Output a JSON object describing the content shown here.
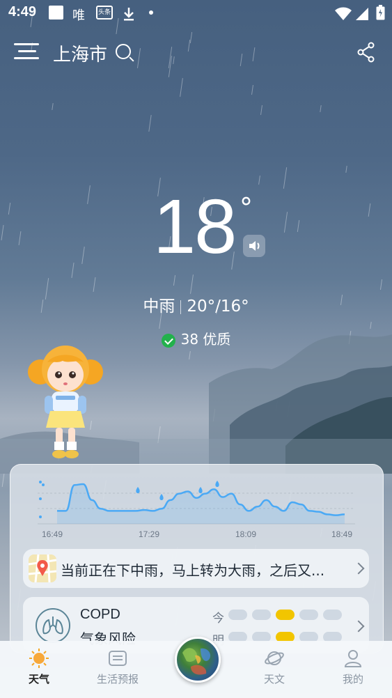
{
  "status_bar": {
    "time": "4:49",
    "icons": [
      "app-icon-white",
      "app-icon-wei",
      "toutiao-icon",
      "download-icon",
      "dot-icon",
      "wifi-icon",
      "signal-icon",
      "battery-icon"
    ],
    "wei_label": "唯",
    "toutiao_label": "头条"
  },
  "header": {
    "city": "上海市",
    "icons": [
      "menu-icon",
      "search-icon",
      "share-icon"
    ]
  },
  "current": {
    "temperature": "18",
    "degree_symbol": "°",
    "condition": "中雨",
    "range": "20°/16°",
    "aqi_value": "38",
    "aqi_label": "优质"
  },
  "forecast_card": {
    "time_ticks": [
      "16:49",
      "17:29",
      "18:09",
      "18:49"
    ],
    "message": "当前正在下中雨，马上转为大雨，之后又...",
    "copd": {
      "title": "COPD",
      "subtitle": "气象风险",
      "today_label": "今",
      "tomorrow_label": "明",
      "today_level": 3,
      "tomorrow_level": 3,
      "levels_total": 5
    }
  },
  "chart_data": {
    "type": "area",
    "x": [
      "16:49",
      "17:29",
      "18:09",
      "18:49"
    ],
    "series": [
      {
        "values": [
          0.3,
          0.3,
          0.9,
          0.92,
          0.55,
          0.35,
          0.3,
          0.3,
          0.3,
          0.3,
          0.32,
          0.3,
          0.35,
          0.55,
          0.7,
          0.75,
          0.6,
          0.7,
          0.8,
          0.62,
          0.7,
          0.45,
          0.3,
          0.4,
          0.55,
          0.4,
          0.3,
          0.5,
          0.45,
          0.3,
          0.28,
          0.22,
          0.2,
          0.22
        ]
      }
    ],
    "color": "#4aa9f5",
    "ylim": [
      0,
      1
    ]
  },
  "bottom_nav": {
    "items": [
      {
        "label": "天气",
        "icon": "sun-icon",
        "active": true
      },
      {
        "label": "生活预报",
        "icon": "folder-icon",
        "active": false
      },
      {
        "label": "",
        "icon": "radar-globe-icon",
        "active": false
      },
      {
        "label": "天文",
        "icon": "planet-icon",
        "active": false
      },
      {
        "label": "我的",
        "icon": "profile-icon",
        "active": false
      }
    ]
  },
  "colors": {
    "accent_yellow": "#f2c500",
    "chart_blue": "#4aa9f5",
    "aqi_green": "#22b14c"
  }
}
